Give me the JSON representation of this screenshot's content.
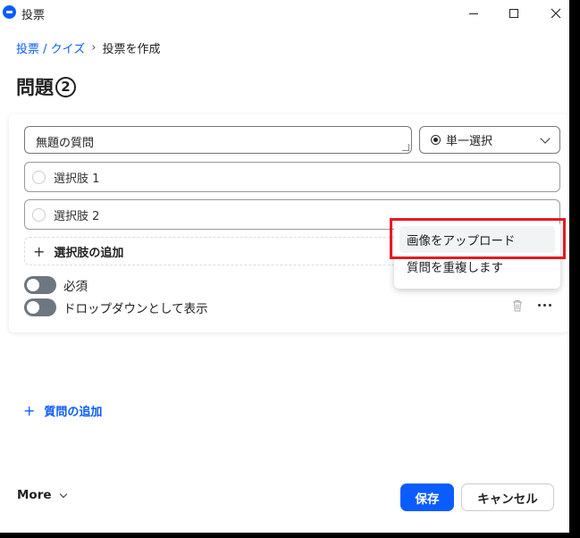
{
  "window": {
    "title": "投票",
    "minimize_icon": "minimize-icon",
    "maximize_icon": "maximize-icon",
    "close_icon": "close-icon"
  },
  "breadcrumb": {
    "parent": "投票 / クイズ",
    "separator": "›",
    "current": "投票を作成"
  },
  "page": {
    "title": "問題",
    "badge": "2"
  },
  "question": {
    "value": "無題の質問",
    "type_label": "単一選択",
    "options": [
      {
        "label": "選択肢 1"
      },
      {
        "label": "選択肢 2"
      }
    ],
    "add_option_label": "選択肢の追加",
    "required_label": "必須",
    "dropdown_label": "ドロップダウンとして表示"
  },
  "context_menu": {
    "items": [
      {
        "label": "画像をアップロード"
      },
      {
        "label": "質問を重複します"
      }
    ],
    "highlight_color": "#e31b23"
  },
  "add_question_label": "質問の追加",
  "footer": {
    "more_label": "More",
    "save_label": "保存",
    "cancel_label": "キャンセル"
  },
  "colors": {
    "accent": "#0b5cff",
    "toggle_off": "#6e7680"
  }
}
